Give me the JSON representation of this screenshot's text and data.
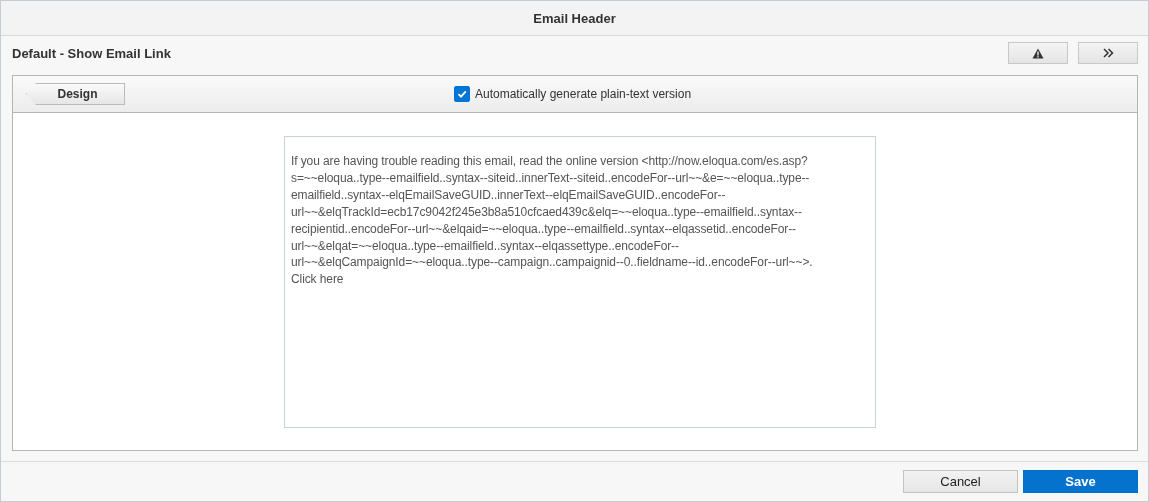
{
  "window": {
    "title": "Email Header"
  },
  "header": {
    "title": "Default - Show Email Link",
    "buttons": [
      {
        "kind": "warning"
      },
      {
        "kind": "expand"
      }
    ]
  },
  "toolbar": {
    "design_button": "Design",
    "auto_plain_text": {
      "label": "Automatically generate plain-text version",
      "checked": true
    }
  },
  "editor": {
    "lines": [
      "If you are having trouble reading this email, read the online version <http://now.eloqua.com/es.asp?",
      "s=~~eloqua..type--emailfield..syntax--siteid..innerText--siteid..encodeFor--url~~&e=~~eloqua..type--",
      "emailfield..syntax--elqEmailSaveGUID..innerText--elqEmailSaveGUID..encodeFor--",
      "url~~&elqTrackId=ecb17c9042f245e3b8a510cfcaed439c&elq=~~eloqua..type--emailfield..syntax--",
      "recipientid..encodeFor--url~~&elqaid=~~eloqua..type--emailfield..syntax--elqassetid..encodeFor--",
      "url~~&elqat=~~eloqua..type--emailfield..syntax--elqassettype..encodeFor--",
      "url~~&elqCampaignId=~~eloqua..type--campaign..campaignid--0..fieldname--id..encodeFor--url~~>.",
      "Click here"
    ]
  },
  "footer": {
    "buttons": [
      {
        "label": "Cancel",
        "kind": "secondary"
      },
      {
        "label": "Save",
        "kind": "primary"
      }
    ]
  }
}
